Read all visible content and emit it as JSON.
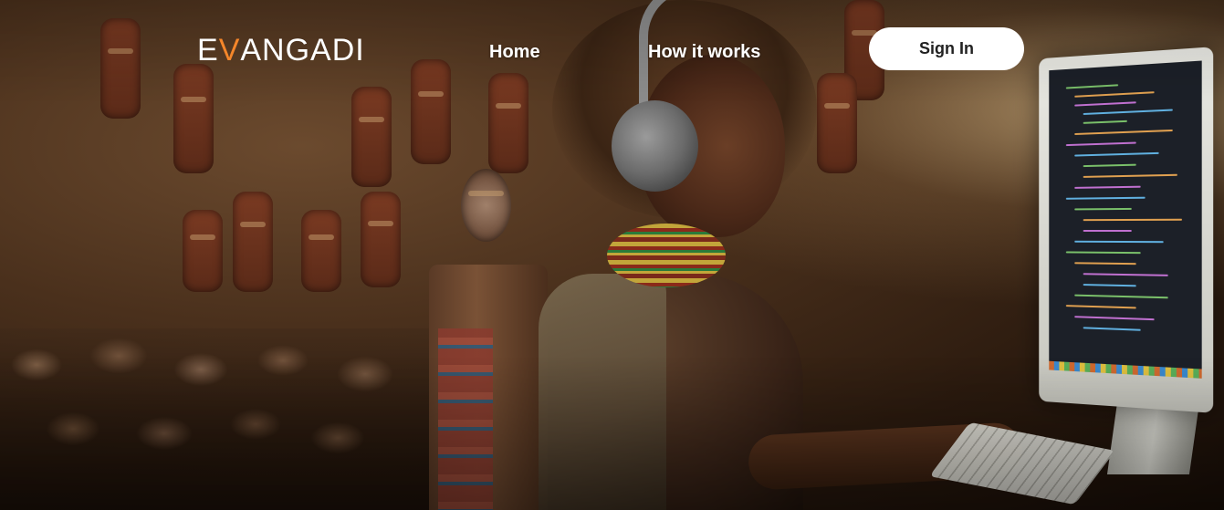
{
  "brand": {
    "logo_prefix": "E",
    "logo_accent": "V",
    "logo_suffix": "ANGADI",
    "accent_color": "#f5862a"
  },
  "nav": {
    "home_label": "Home",
    "how_it_works_label": "How it works",
    "sign_in_label": "Sign In"
  },
  "hero": {
    "background": "photo of a child with headphones coding at a desktop computer"
  }
}
